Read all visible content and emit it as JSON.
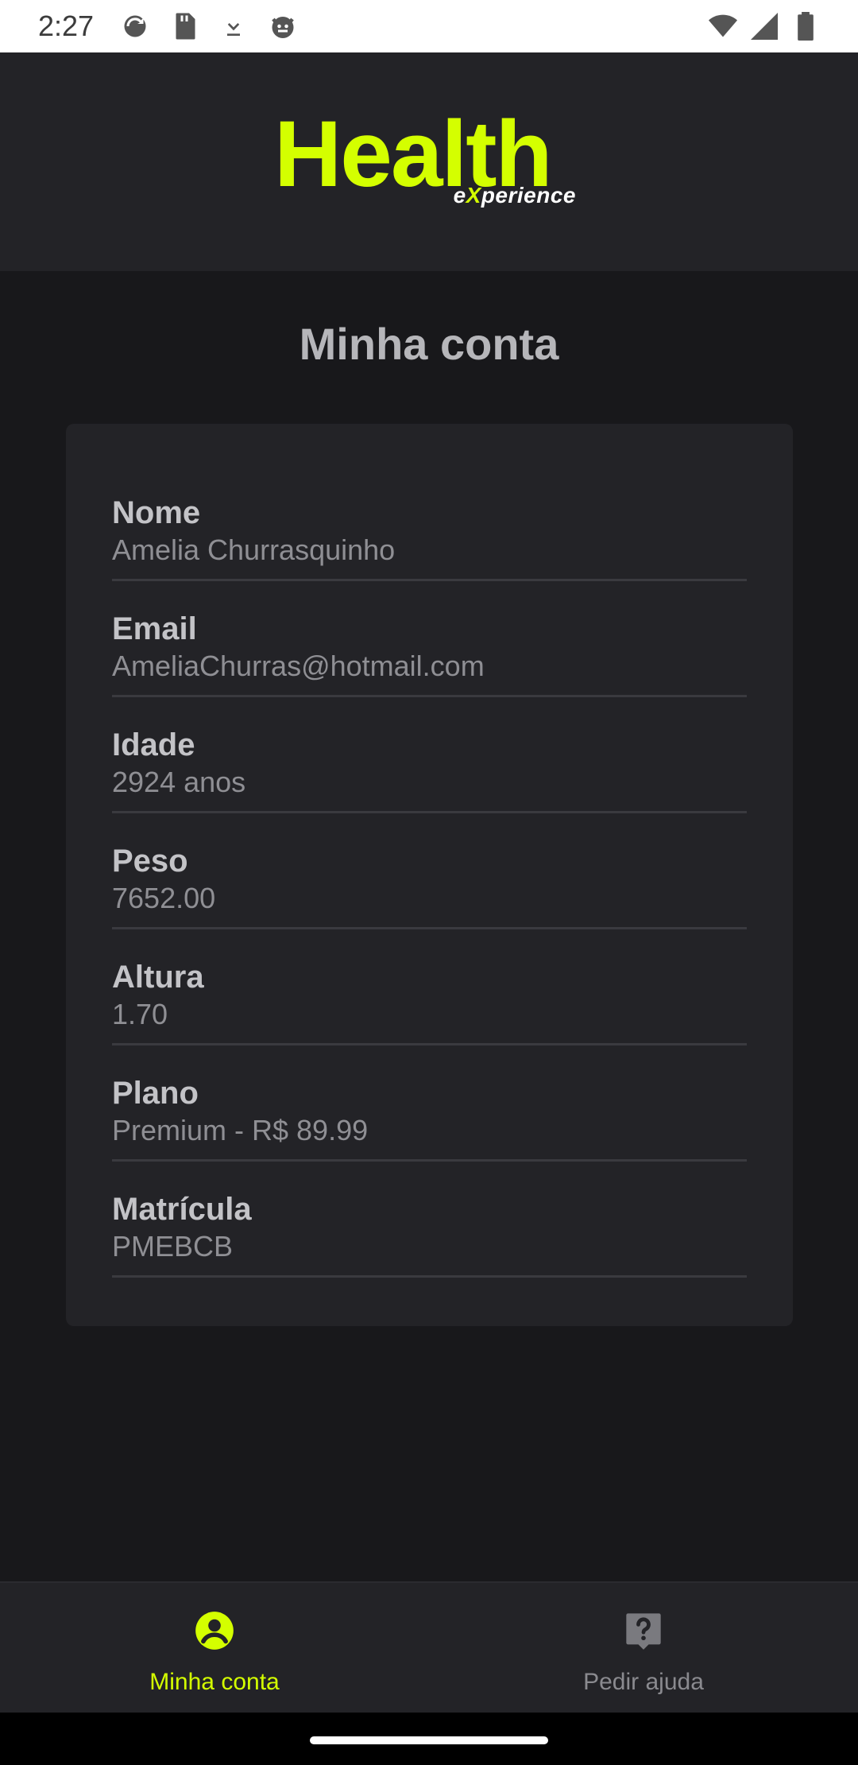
{
  "status_bar": {
    "time": "2:27",
    "left_icons": [
      "sync-icon",
      "sd-card-icon",
      "download-icon",
      "cat-face-icon"
    ],
    "right_icons": [
      "wifi-icon",
      "signal-icon",
      "battery-icon"
    ]
  },
  "brand": {
    "main": "Health",
    "sub_prefix": "e",
    "sub_x": "X",
    "sub_suffix": "perience",
    "accent": "#d4ff00"
  },
  "page": {
    "title": "Minha conta"
  },
  "profile": {
    "fields": [
      {
        "label": "Nome",
        "value": "Amelia Churrasquinho"
      },
      {
        "label": "Email",
        "value": "AmeliaChurras@hotmail.com"
      },
      {
        "label": "Idade",
        "value": "2924 anos"
      },
      {
        "label": "Peso",
        "value": "7652.00"
      },
      {
        "label": "Altura",
        "value": "1.70"
      },
      {
        "label": "Plano",
        "value": "Premium - R$ 89.99"
      },
      {
        "label": "Matrícula",
        "value": "PMEBCB"
      }
    ]
  },
  "bottom_nav": {
    "items": [
      {
        "label": "Minha conta",
        "icon": "account-circle-icon",
        "active": true
      },
      {
        "label": "Pedir ajuda",
        "icon": "help-icon",
        "active": false
      }
    ]
  },
  "colors": {
    "background": "#18181b",
    "surface": "#232327",
    "accent": "#d4ff00",
    "inactive": "#8a8a8f"
  }
}
